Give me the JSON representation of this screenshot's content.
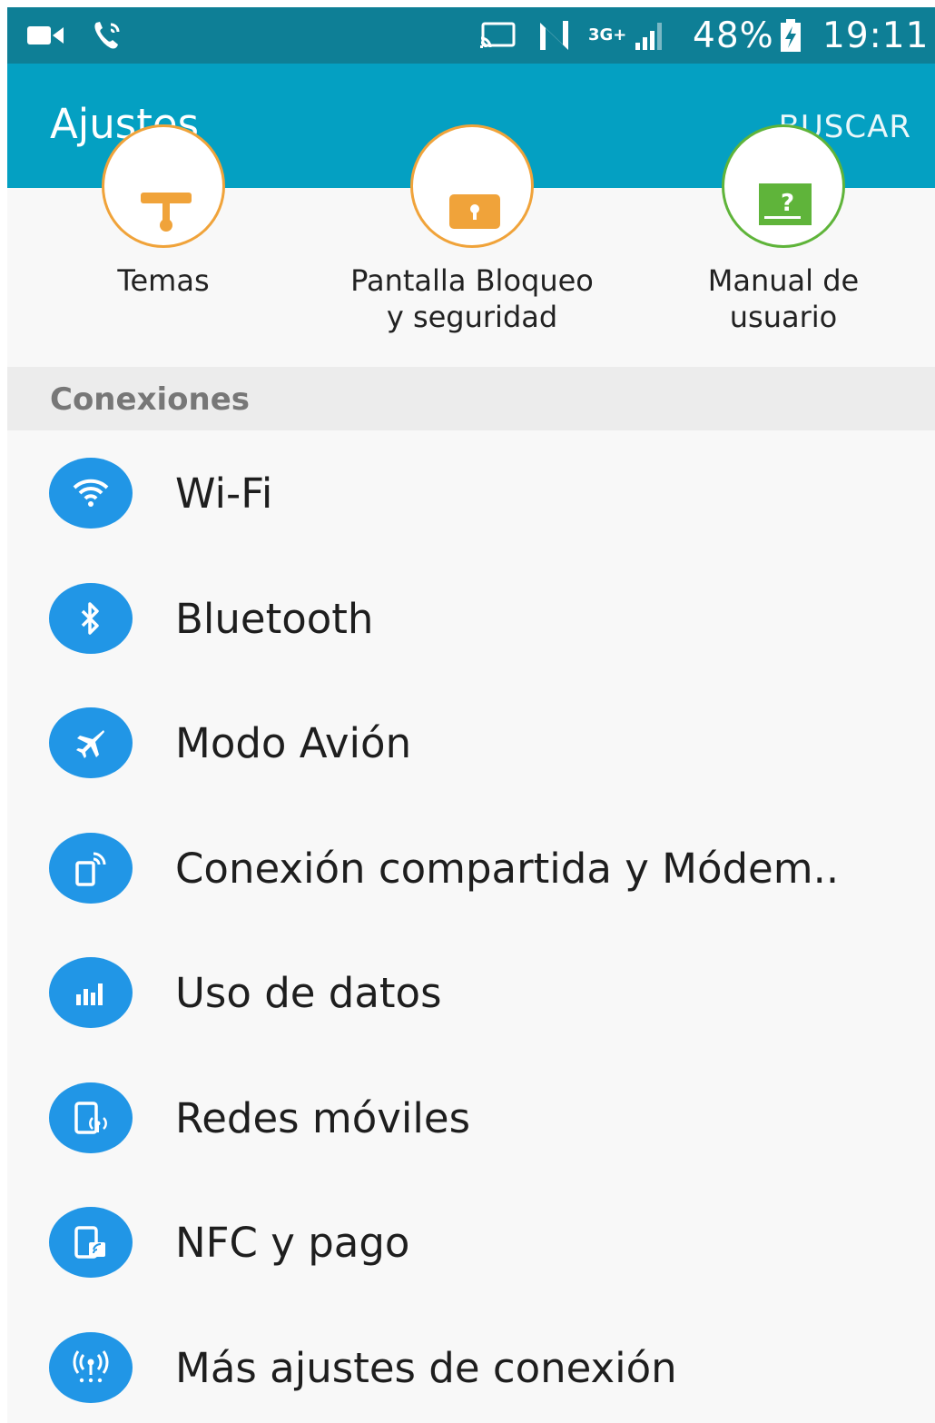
{
  "status_bar": {
    "battery": "48%",
    "time": "19:11",
    "network_type": "3G+",
    "icons": [
      "video-call-icon",
      "wifi-call-icon",
      "screen-mirror-icon",
      "nfc-icon",
      "signal-icon",
      "battery-charging-icon"
    ]
  },
  "app_bar": {
    "title": "Ajustes",
    "action": "BUSCAR"
  },
  "shortcuts": [
    {
      "line1": "Temas",
      "line2": "",
      "icon": "paint-roller-icon",
      "color": "#f0a33a"
    },
    {
      "line1": "Pantalla Bloqueo",
      "line2": "y seguridad",
      "icon": "lock-icon",
      "color": "#f0a33a"
    },
    {
      "line1": "Manual de",
      "line2": "usuario",
      "icon": "help-book-icon",
      "color": "#5fb43a"
    }
  ],
  "section": {
    "title": "Conexiones"
  },
  "items": [
    {
      "label": "Wi-Fi",
      "icon": "wifi-icon"
    },
    {
      "label": "Bluetooth",
      "icon": "bluetooth-icon"
    },
    {
      "label": "Modo Avión",
      "icon": "airplane-icon"
    },
    {
      "label": "Conexión compartida y Módem..",
      "icon": "hotspot-icon"
    },
    {
      "label": "Uso de datos",
      "icon": "data-usage-icon"
    },
    {
      "label": "Redes móviles",
      "icon": "mobile-network-icon"
    },
    {
      "label": "NFC y pago",
      "icon": "nfc-payment-icon"
    },
    {
      "label": "Más ajustes de conexión",
      "icon": "more-connections-icon"
    }
  ],
  "colors": {
    "status_bar": "#0e7f96",
    "app_bar": "#04a0c2",
    "icon_bg": "#2196e6"
  }
}
